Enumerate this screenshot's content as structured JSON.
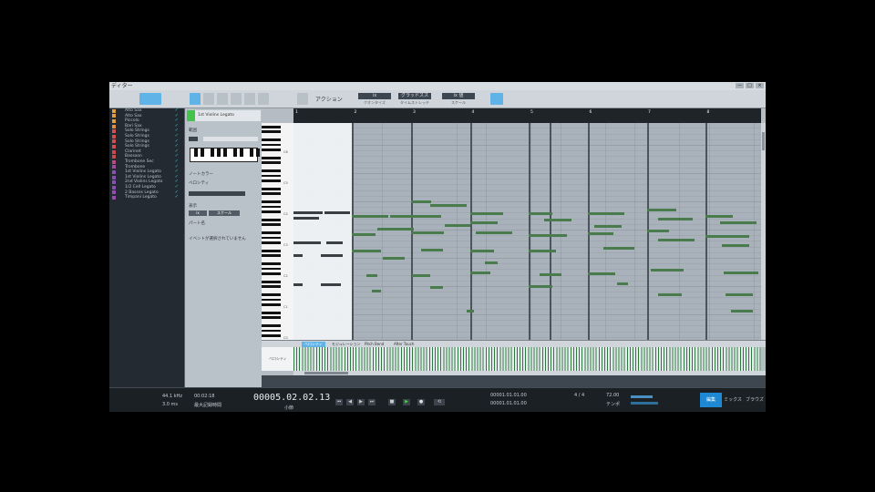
{
  "window": {
    "title": "ディター",
    "controls": [
      "—",
      "□",
      "×"
    ]
  },
  "toolbar": {
    "action_label": "アクション",
    "segments": [
      {
        "label": "ix",
        "sub": "クオンタイズ"
      },
      {
        "label": "グラッドスス",
        "sub": "タイムストレッチ"
      },
      {
        "label": "ix 値",
        "sub": "スケール"
      }
    ]
  },
  "tracks": [
    {
      "name": "Alto Sax",
      "color": "#e0a040"
    },
    {
      "name": "Alto Sax",
      "color": "#e0a040"
    },
    {
      "name": "Piccolo",
      "color": "#e0a040"
    },
    {
      "name": "Bari Sax",
      "color": "#e09040"
    },
    {
      "name": "Solo Strings",
      "color": "#d05050"
    },
    {
      "name": "Solo Strings",
      "color": "#d05050"
    },
    {
      "name": "Solo Strings",
      "color": "#d05050"
    },
    {
      "name": "Solo Strings",
      "color": "#d05050"
    },
    {
      "name": "Clarinet",
      "color": "#d04848"
    },
    {
      "name": "Bassoon",
      "color": "#c84a4a"
    },
    {
      "name": "Trombone Sec",
      "color": "#b84a8a"
    },
    {
      "name": "Trombone",
      "color": "#a04aa0"
    },
    {
      "name": "1st Violins Legato",
      "color": "#8a50b0"
    },
    {
      "name": "1st Violins Legato",
      "color": "#8a50b0"
    },
    {
      "name": "2nd Violins Legato",
      "color": "#8a50b0"
    },
    {
      "name": "1/2 Cell Legato",
      "color": "#8a50b0"
    },
    {
      "name": "2 Basses Legato",
      "color": "#9a4ab0"
    },
    {
      "name": "Timpani Legato",
      "color": "#9a4ab0"
    }
  ],
  "inspector": {
    "track_name": "1st Violins Legato",
    "section1": "範囲",
    "section2": "ノートカラー",
    "section3": "ベロシティ",
    "section4": "表示",
    "button_a": "ix",
    "button_b": "スケール",
    "scale_label": "パート名",
    "note_label": "イベントが選択されていません"
  },
  "ruler": {
    "markers": [
      "1",
      "2",
      "3",
      "4",
      "5",
      "6",
      "7",
      "8"
    ]
  },
  "keyboard": {
    "octaves": [
      "C6",
      "C5",
      "C4",
      "C3",
      "C2",
      "C1",
      "C0"
    ]
  },
  "lanes": {
    "tabs": [
      "ベロシティ",
      "モジュレーション",
      "Pitch Bend",
      "After Touch"
    ],
    "velocity_label": "ベロシティ"
  },
  "transport": {
    "sample_rate": "44.1 kHz",
    "latency": "3.0 ms",
    "time": "00:02:18",
    "tempo_label": "最大記録時間",
    "position": "00005.02.02.13",
    "position_sub": "小節",
    "loop_start": "00001.01.01.00",
    "loop_end": "00001.01.01.00",
    "signature": "4 / 4",
    "tempo": "72.00",
    "tempo_sub": "テンポ"
  },
  "tabs": [
    "編集",
    "ミックス",
    "ブラウズ"
  ],
  "colors": {
    "accent": "#1e89d2",
    "note": "#4a7b4d",
    "grid": "#a9b2bb",
    "play": "#47d14b"
  }
}
